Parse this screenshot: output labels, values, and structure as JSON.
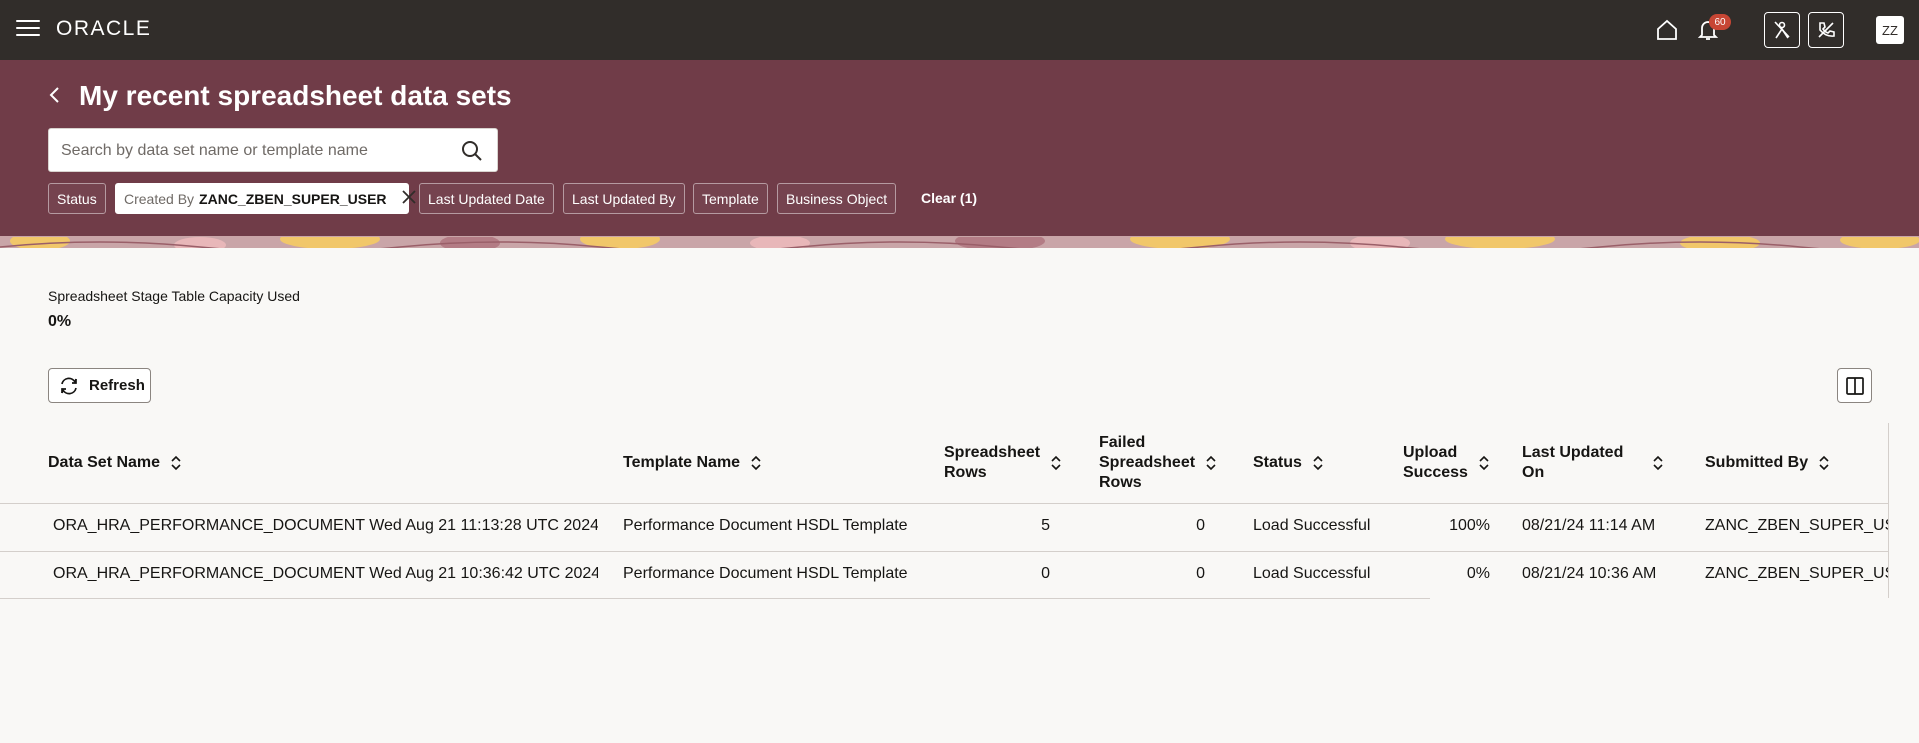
{
  "topbar": {
    "logo": "ORACLE",
    "notification_count": "60",
    "avatar_initials": "ZZ"
  },
  "header": {
    "title": "My recent spreadsheet data sets",
    "search_placeholder": "Search by data set name or template name",
    "filters": {
      "status": "Status",
      "created_by_prefix": "Created By",
      "created_by_value": "ZANC_ZBEN_SUPER_USER",
      "last_updated_date": "Last Updated Date",
      "last_updated_by": "Last Updated By",
      "template": "Template",
      "business_object": "Business Object",
      "clear": "Clear (1)"
    }
  },
  "capacity": {
    "label": "Spreadsheet Stage Table Capacity Used",
    "value": "0%"
  },
  "toolbar": {
    "refresh_label": "Refresh"
  },
  "table": {
    "columns": {
      "data_set_name": "Data Set Name",
      "template_name": "Template Name",
      "spreadsheet_rows_1": "Spreadsheet",
      "spreadsheet_rows_2": "Rows",
      "failed_1": "Failed",
      "failed_2": "Spreadsheet",
      "failed_3": "Rows",
      "status": "Status",
      "upload_1": "Upload",
      "upload_2": "Success",
      "updated_1": "Last Updated",
      "updated_2": "On",
      "submitted_by": "Submitted By"
    },
    "rows": [
      {
        "data_set_name": "ORA_HRA_PERFORMANCE_DOCUMENT Wed Aug 21 11:13:28 UTC 2024",
        "template_name": "Performance Document HSDL Template",
        "spreadsheet_rows": "5",
        "failed_rows": "0",
        "status": "Load Successful",
        "upload_success": "100%",
        "last_updated_on": "08/21/24 11:14 AM",
        "submitted_by": "ZANC_ZBEN_SUPER_USER"
      },
      {
        "data_set_name": "ORA_HRA_PERFORMANCE_DOCUMENT Wed Aug 21 10:36:42 UTC 2024",
        "template_name": "Performance Document HSDL Template",
        "spreadsheet_rows": "0",
        "failed_rows": "0",
        "status": "Load Successful",
        "upload_success": "0%",
        "last_updated_on": "08/21/24 10:36 AM",
        "submitted_by": "ZANC_ZBEN_SUPER_USER"
      }
    ]
  }
}
